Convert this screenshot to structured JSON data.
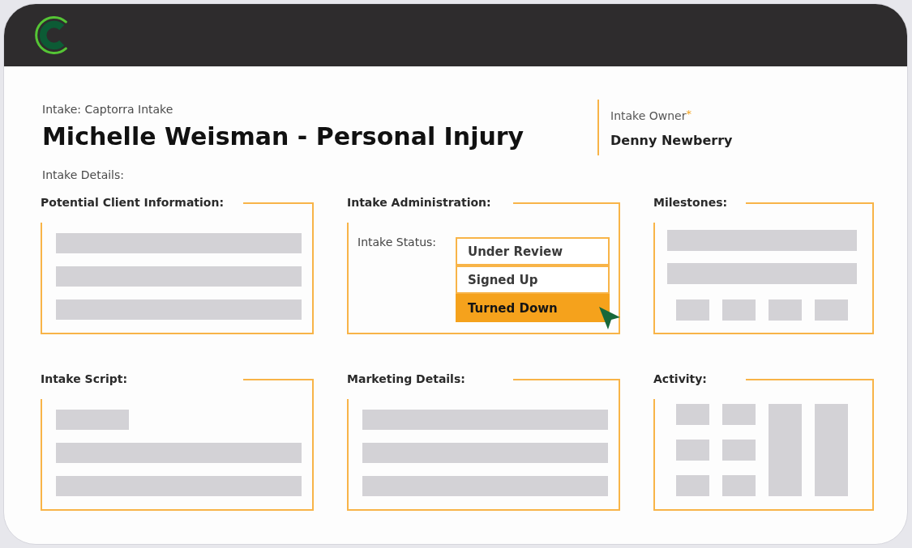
{
  "intake": {
    "type_label": "Intake: Captorra Intake",
    "title": "Michelle Weisman - Personal Injury",
    "details_label": "Intake Details:"
  },
  "owner": {
    "label": "Intake Owner",
    "required_mark": "*",
    "value": "Denny Newberry"
  },
  "panels": [
    {
      "title": "Potential Client Information:",
      "kind": "lines"
    },
    {
      "title": "Intake Administration:",
      "kind": "status",
      "status": {
        "label": "Intake Status:",
        "options": [
          {
            "label": "Under Review",
            "selected": false
          },
          {
            "label": "Signed Up",
            "selected": false
          },
          {
            "label": "Turned Down",
            "selected": true
          }
        ]
      }
    },
    {
      "title": "Milestones:",
      "kind": "milestones"
    },
    {
      "title": "Intake Script:",
      "kind": "script"
    },
    {
      "title": "Marketing Details:",
      "kind": "lines"
    },
    {
      "title": "Activity:",
      "kind": "activity"
    }
  ]
}
